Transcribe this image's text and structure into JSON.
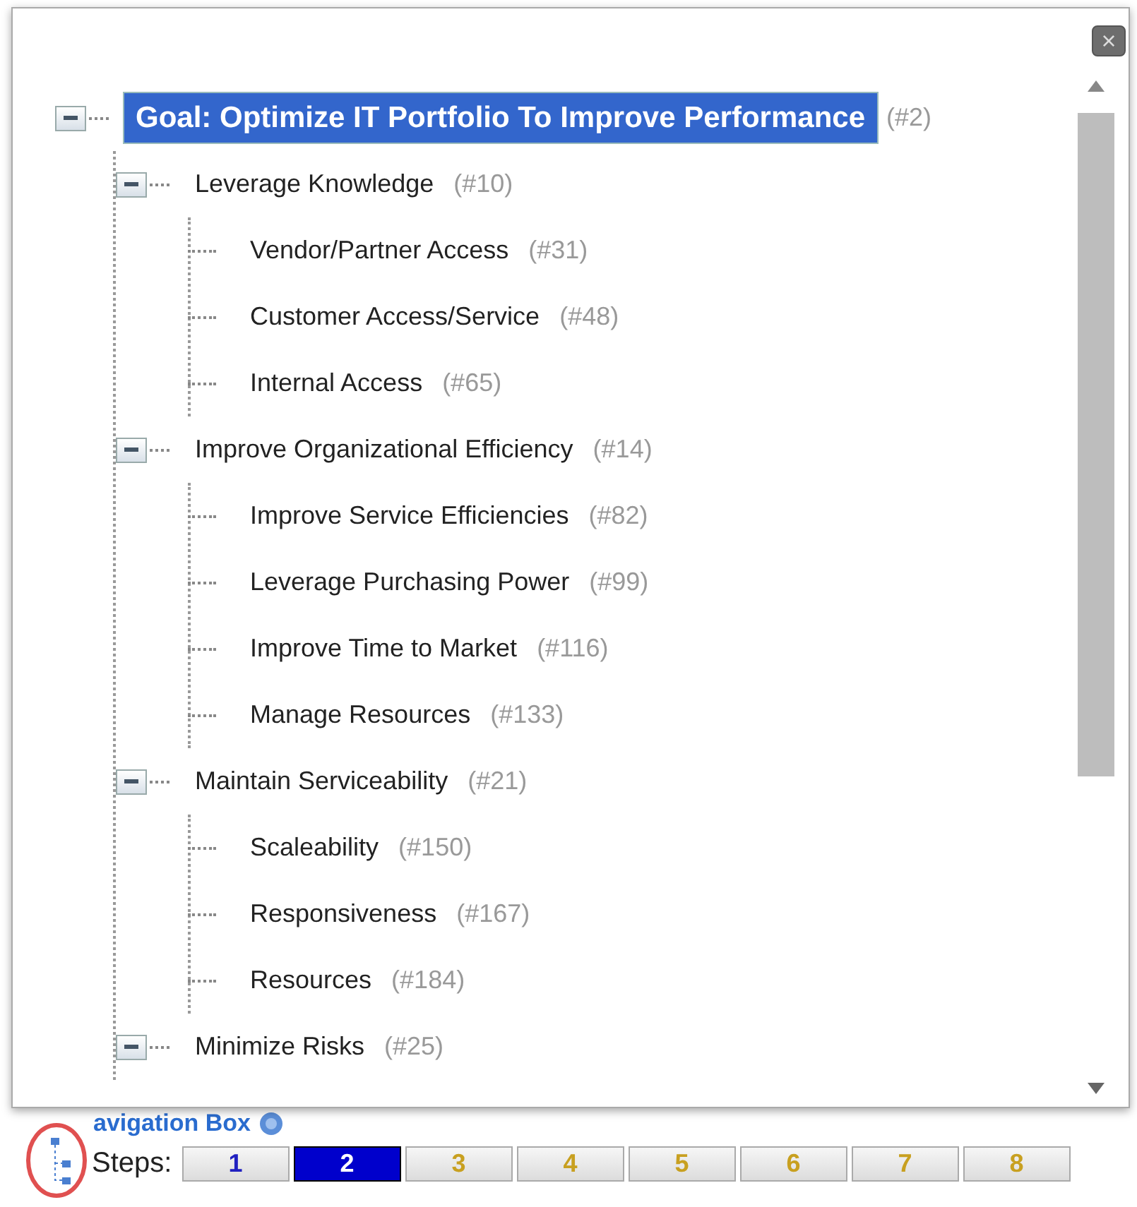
{
  "tree": [
    {
      "label": "Goal: Optimize IT Portfolio To Improve Performance",
      "number": "(#2)",
      "selected": true,
      "expanded": true,
      "children": [
        {
          "label": "Leverage Knowledge",
          "number": "(#10)",
          "selected": false,
          "expanded": true,
          "children": [
            {
              "label": "Vendor/Partner Access",
              "number": "(#31)",
              "selected": false
            },
            {
              "label": "Customer Access/Service",
              "number": "(#48)",
              "selected": false
            },
            {
              "label": "Internal Access",
              "number": "(#65)",
              "selected": false
            }
          ]
        },
        {
          "label": "Improve Organizational Efficiency",
          "number": "(#14)",
          "selected": false,
          "expanded": true,
          "children": [
            {
              "label": "Improve Service Efficiencies",
              "number": "(#82)",
              "selected": false
            },
            {
              "label": "Leverage Purchasing Power",
              "number": "(#99)",
              "selected": false
            },
            {
              "label": "Improve Time to Market",
              "number": "(#116)",
              "selected": false
            },
            {
              "label": "Manage Resources",
              "number": "(#133)",
              "selected": false
            }
          ]
        },
        {
          "label": "Maintain Serviceability",
          "number": "(#21)",
          "selected": false,
          "expanded": true,
          "children": [
            {
              "label": "Scaleability",
              "number": "(#150)",
              "selected": false
            },
            {
              "label": "Responsiveness",
              "number": "(#167)",
              "selected": false
            },
            {
              "label": "Resources",
              "number": "(#184)",
              "selected": false
            }
          ]
        },
        {
          "label": "Minimize Risks",
          "number": "(#25)",
          "selected": false,
          "expanded": true
        }
      ]
    }
  ],
  "close_button": "×",
  "navigation_box": {
    "title": "avigation Box"
  },
  "steps": {
    "label": "Steps:",
    "items": [
      {
        "label": "1",
        "selected": false,
        "color": "#2020c0"
      },
      {
        "label": "2",
        "selected": true
      },
      {
        "label": "3",
        "selected": false,
        "color": "#c8a020"
      },
      {
        "label": "4",
        "selected": false,
        "color": "#c8a020"
      },
      {
        "label": "5",
        "selected": false,
        "color": "#c8a020"
      },
      {
        "label": "6",
        "selected": false,
        "color": "#c8a020"
      },
      {
        "label": "7",
        "selected": false,
        "color": "#c8a020"
      },
      {
        "label": "8",
        "selected": false,
        "color": "#c8a020"
      }
    ]
  }
}
